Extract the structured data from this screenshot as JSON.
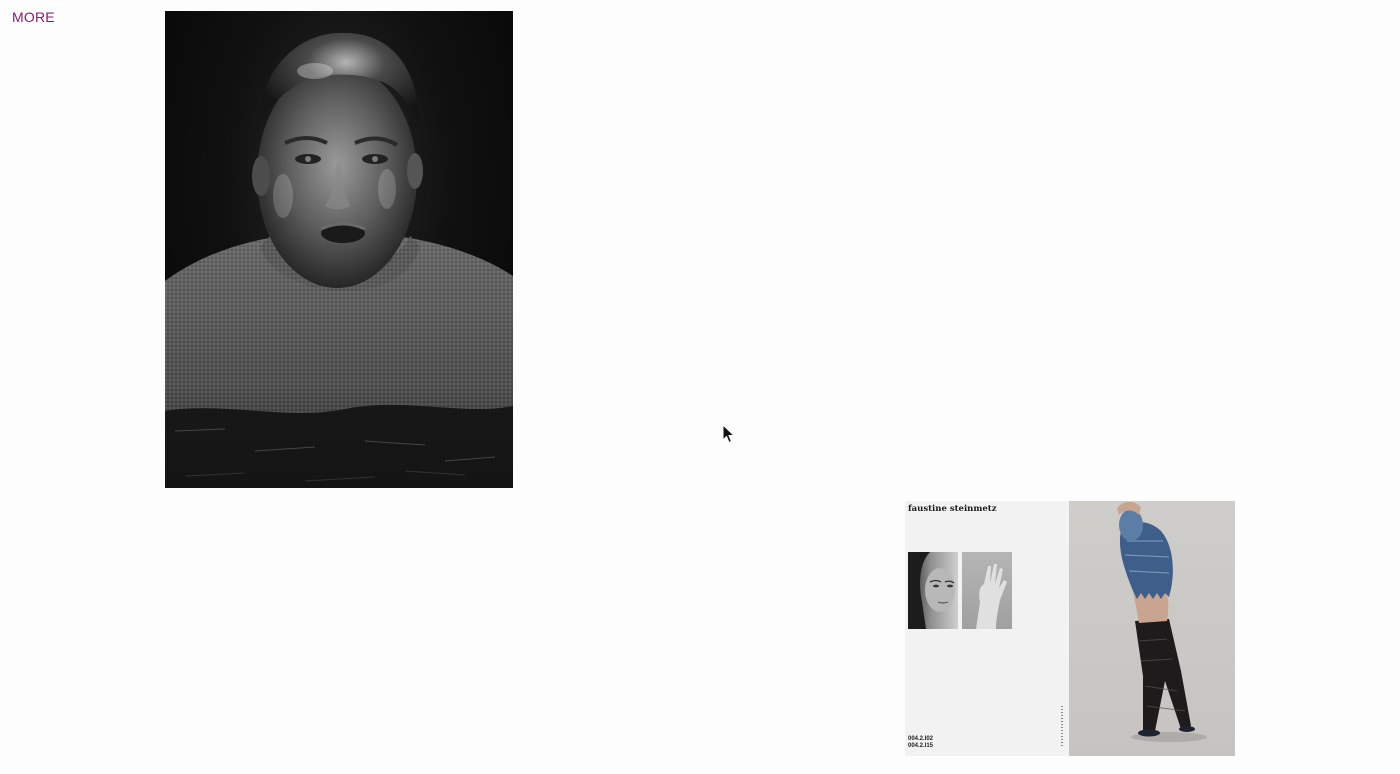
{
  "nav": {
    "more_label": "MORE"
  },
  "spread": {
    "title": "faustine steinmetz",
    "codes": [
      "004.2.I02",
      "004.2.I15"
    ]
  },
  "colors": {
    "accent": "#8b1a6e",
    "background": "#fdfdfd"
  },
  "icons": {
    "cursor": "arrow-cursor-icon"
  }
}
